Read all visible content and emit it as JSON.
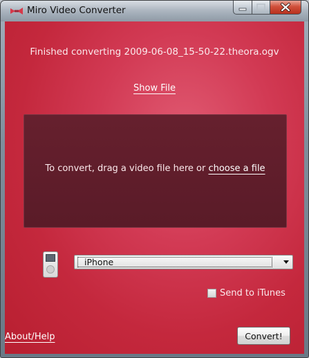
{
  "window": {
    "title": "Miro Video Converter",
    "icon": "miro-logo-icon",
    "controls": {
      "minimize_icon": "minimize-icon",
      "maximize_icon": "maximize-icon",
      "close_icon": "close-icon"
    }
  },
  "status": {
    "message": "Finished converting 2009-06-08_15-50-22.theora.ogv",
    "show_file_label": "Show File"
  },
  "drop_zone": {
    "instruction": "To convert, drag a video file here or ",
    "choose_link": "choose a file"
  },
  "device": {
    "icon": "ipod-icon",
    "selected": "iPhone"
  },
  "send_to_itunes": {
    "label": "Send to iTunes",
    "checked": false
  },
  "footer": {
    "about_label": "About/Help",
    "convert_label": "Convert!"
  },
  "colors": {
    "background": "#c4283d",
    "drop_zone": "#5e1d2a",
    "text": "#fbe9ec"
  }
}
